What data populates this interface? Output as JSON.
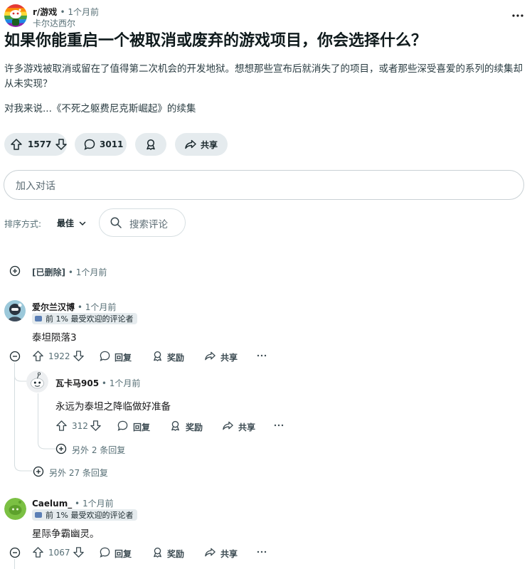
{
  "post": {
    "subreddit": "r/游戏",
    "time": "1个月前",
    "author": "卡尔达西尔",
    "title": "如果你能重启一个被取消或废弃的游戏项目，你会选择什么？",
    "body_line1": "许多游戏被取消或留在了值得第二次机会的开发地狱。想想那些宣布后就消失了的项目，或者那些深受喜爱的系列的续集却从未实现？",
    "body_line2": "对我来说...《不死之躯费尼克斯崛起》的续集",
    "votes": "1577",
    "comments": "3011",
    "share_label": "共享"
  },
  "join": {
    "placeholder": "加入对话"
  },
  "sort": {
    "label": "排序方式:",
    "value": "最佳"
  },
  "search": {
    "placeholder": "搜索评论"
  },
  "comments": [
    {
      "deleted_label": "[已删除]",
      "time": "1个月前"
    },
    {
      "author": "爱尔兰汉博",
      "time": "1个月前",
      "flair": "前 1% 最受欢迎的评论者",
      "body": "泰坦陨落3",
      "votes": "1922",
      "reply_label": "回复",
      "award_label": "奖励",
      "share_label": "共享",
      "more_replies": "另外 27 条回复"
    },
    {
      "author": "瓦卡马905",
      "time": "1个月前",
      "body": "永远为泰坦之降临做好准备",
      "votes": "312",
      "reply_label": "回复",
      "award_label": "奖励",
      "share_label": "共享",
      "more_replies": "另外 2 条回复"
    },
    {
      "author": "Caelum_",
      "time": "1个月前",
      "flair": "前 1% 最受欢迎的评论者",
      "body": "星际争霸幽灵。",
      "votes": "1067",
      "reply_label": "回复",
      "award_label": "奖励",
      "share_label": "共享"
    }
  ],
  "icons": {
    "subreddit_avatar": "rainbow-snoo-avatar",
    "upvote": "arrow-up-icon",
    "downvote": "arrow-down-icon",
    "comment": "speech-bubble-icon",
    "award": "award-ribbon-icon",
    "share": "share-arrow-icon",
    "more": "ellipsis-icon",
    "expand": "plus-circle-icon",
    "collapse": "minus-circle-icon"
  },
  "colors": {
    "pill_bg": "#e5ebee",
    "muted_text": "#576f76",
    "border": "#c9d1d5"
  }
}
